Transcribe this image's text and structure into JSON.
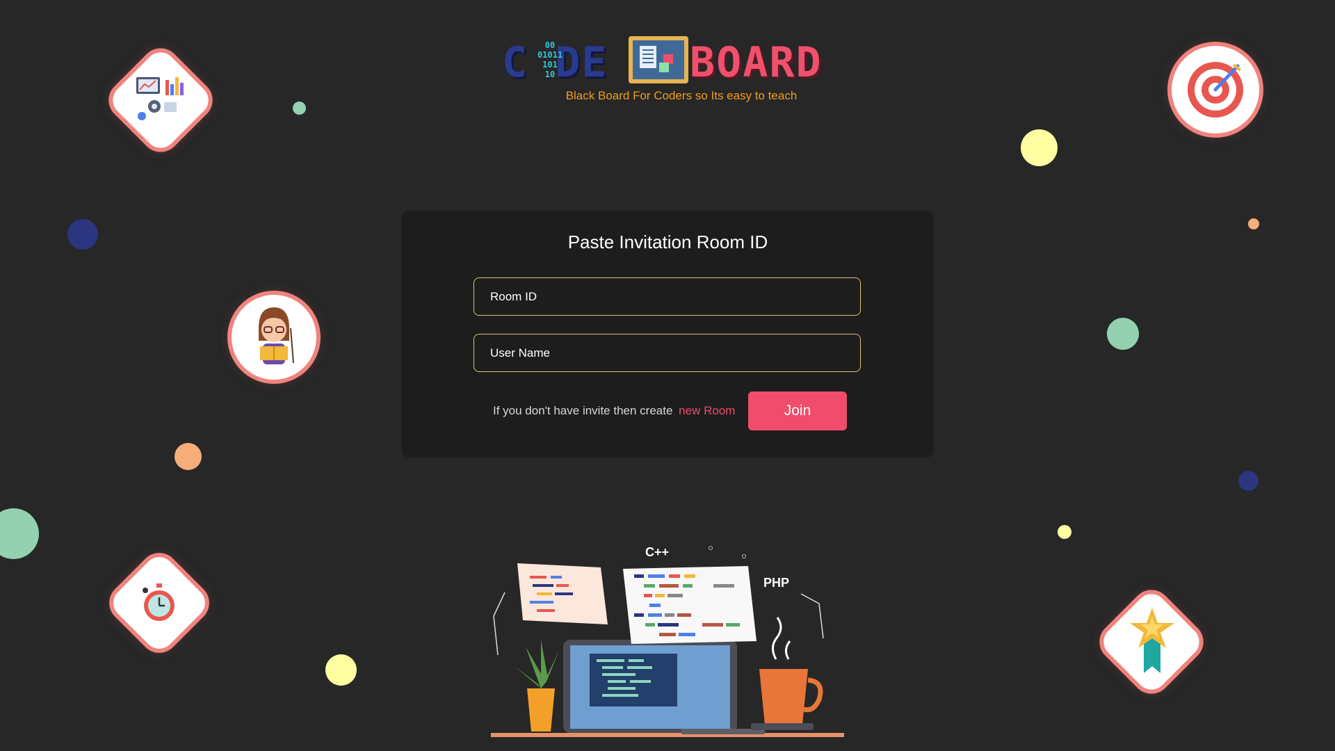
{
  "logo": {
    "left_text": "C DE",
    "right_text": "BOARD",
    "binary": "00\n01011\n101\n10",
    "tagline": "Black Board For Coders so Its easy to teach"
  },
  "form": {
    "title": "Paste Invitation Room ID",
    "room_id_placeholder": "Room ID",
    "user_name_placeholder": "User Name",
    "invite_text": "If you don't have invite then create",
    "new_room_link": "new Room",
    "join_label": "Join"
  },
  "illustration": {
    "cpp_label": "C++",
    "php_label": "PHP"
  },
  "colors": {
    "background": "#272727",
    "card": "#1d1d1d",
    "accent": "#f04c6c",
    "field_border": "#e6c07b",
    "tagline": "#f39c1e"
  },
  "icons": [
    "analytics-icon",
    "teacher-icon",
    "stopwatch-icon",
    "target-icon",
    "star-medal-icon",
    "coding-laptop-illustration"
  ]
}
